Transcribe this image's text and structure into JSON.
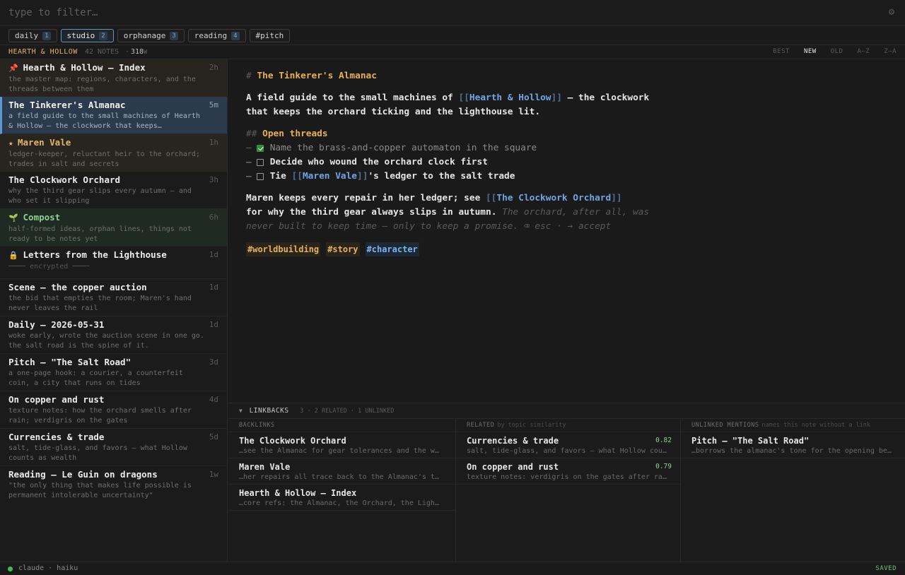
{
  "filter": {
    "placeholder": "type to filter…"
  },
  "tabs": [
    {
      "label": "daily",
      "count": "1"
    },
    {
      "label": "studio",
      "count": "2"
    },
    {
      "label": "orphanage",
      "count": "3"
    },
    {
      "label": "reading",
      "count": "4"
    },
    {
      "label": "#pitch",
      "count": ""
    }
  ],
  "vault": {
    "name": "HEARTH & HOLLOW",
    "notes": "42 NOTES",
    "sep": "·",
    "words": "318",
    "words_unit": "W"
  },
  "sort": [
    "BEST",
    "NEW",
    "OLD",
    "A–Z",
    "Z–A"
  ],
  "notes": [
    {
      "glyph": "📌",
      "title": "Hearth & Hollow — Index",
      "time": "2h",
      "snippet": "the master map: regions, characters, and the threads between them"
    },
    {
      "glyph": "",
      "title": "The Tinkerer's Almanac",
      "time": "5m",
      "snippet": "a field guide to the small machines of Hearth & Hollow — the clockwork that keeps…"
    },
    {
      "glyph": "★",
      "title": "Maren Vale",
      "time": "1h",
      "snippet": "ledger-keeper, reluctant heir to the orchard; trades in salt and secrets"
    },
    {
      "glyph": "",
      "title": "The Clockwork Orchard",
      "time": "3h",
      "snippet": "why the third gear slips every autumn — and who set it slipping"
    },
    {
      "glyph": "🌱",
      "title": "Compost",
      "time": "6h",
      "snippet": "half-formed ideas, orphan lines, things not ready to be notes yet"
    },
    {
      "glyph": "🔒",
      "title": "Letters from the Lighthouse",
      "time": "1d",
      "snippet": "──── encrypted ────"
    },
    {
      "glyph": "",
      "title": "Scene — the copper auction",
      "time": "1d",
      "snippet": "the bid that empties the room; Maren's hand never leaves the rail"
    },
    {
      "glyph": "",
      "title": "Daily — 2026-05-31",
      "time": "1d",
      "snippet": "woke early, wrote the auction scene in one go. the salt road is the spine of it."
    },
    {
      "glyph": "",
      "title": "Pitch — \"The Salt Road\"",
      "time": "3d",
      "snippet": "a one-page hook: a courier, a counterfeit coin, a city that runs on tides"
    },
    {
      "glyph": "",
      "title": "On copper and rust",
      "time": "4d",
      "snippet": "texture notes: how the orchard smells after rain; verdigris on the gates"
    },
    {
      "glyph": "",
      "title": "Currencies & trade",
      "time": "5d",
      "snippet": "salt, tide-glass, and favors — what Hollow counts as wealth"
    },
    {
      "glyph": "",
      "title": "Reading — Le Guin on dragons",
      "time": "1w",
      "snippet": "\"the only thing that makes life possible is permanent intolerable uncertainty\""
    }
  ],
  "editor": {
    "h1_mark": "#",
    "h1": "The Tinkerer's Almanac",
    "p1_a": "A field guide to the small machines of ",
    "p1_link": "Hearth & Hollow",
    "p1_b": " — the clockwork",
    "p1_c": "that keeps the orchard ticking and the lighthouse lit.",
    "h2_mark": "##",
    "h2": "Open threads",
    "task1": "Name the brass-and-copper automaton in the square",
    "task2": "Decide who wound the orchard clock first",
    "task3_a": "Tie ",
    "task3_link": "Maren Vale",
    "task3_b": "'s ledger to the salt trade",
    "p2_a": "Maren keeps every repair in her ledger; see ",
    "p2_link": "The Clockwork Orchard",
    "p2_b": "for why the third gear always slips in autumn.",
    "ghost1": " The orchard, after all, was",
    "ghost2": "never built to keep time — only to keep a promise. ⌫ esc · → accept",
    "tags": [
      "#worldbuilding",
      "#story",
      "#character"
    ]
  },
  "linkbacks": {
    "title": "LINKBACKS",
    "summary": "3 · 2 RELATED · 1 UNLINKED",
    "backlinks_h": "BACKLINKS",
    "related_h": "RELATED",
    "related_hint": "by topic similarity",
    "unlinked_h": "UNLINKED MENTIONS",
    "unlinked_hint": "names this note without a link",
    "backlinks": [
      {
        "title": "The Clockwork Orchard",
        "snippet": "…see the Almanac for gear tolerances and the w…"
      },
      {
        "title": "Maren Vale",
        "snippet": "…her repairs all trace back to the Almanac's t…"
      },
      {
        "title": "Hearth & Hollow — Index",
        "snippet": "…core refs: the Almanac, the Orchard, the Ligh…"
      }
    ],
    "related": [
      {
        "title": "Currencies & trade",
        "score": "0.82",
        "snippet": "salt, tide-glass, and favors — what Hollow cou…"
      },
      {
        "title": "On copper and rust",
        "score": "0.79",
        "snippet": "texture notes: verdigris on the gates after ra…"
      }
    ],
    "unlinked": [
      {
        "title": "Pitch — \"The Salt Road\"",
        "snippet": "…borrows the almanac's tone for the opening be…"
      }
    ]
  },
  "status": {
    "model": "claude · haiku",
    "saved": "SAVED"
  }
}
